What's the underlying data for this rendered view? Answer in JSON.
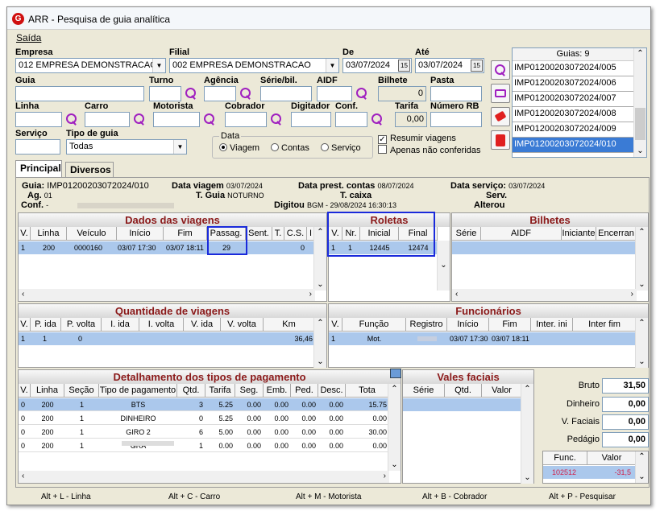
{
  "window": {
    "title": "ARR - Pesquisa de guia analítica",
    "logo": "G"
  },
  "menu": {
    "saida": "Saída"
  },
  "form": {
    "empresa_label": "Empresa",
    "empresa_value": "012 EMPRESA DEMONSTRACAO",
    "filial_label": "Filial",
    "filial_value": "002 EMPRESA DEMONSTRACAO",
    "de_label": "De",
    "de_value": "03/07/2024",
    "ate_label": "Até",
    "ate_value": "03/07/2024",
    "guia_label": "Guia",
    "turno_label": "Turno",
    "agencia_label": "Agência",
    "serie_label": "Série/bil.",
    "aidf_label": "AIDF",
    "bilhete_label": "Bilhete",
    "bilhete_value": "0",
    "pasta_label": "Pasta",
    "linha_label": "Linha",
    "carro_label": "Carro",
    "motorista_label": "Motorista",
    "cobrador_label": "Cobrador",
    "digitador_label": "Digitador",
    "conf_label": "Conf.",
    "tarifa_label": "Tarifa",
    "tarifa_value": "0,00",
    "numero_rb_label": "Número RB",
    "servico_label": "Serviço",
    "tipo_guia_label": "Tipo de guia",
    "tipo_guia_value": "Todas",
    "data_group_label": "Data",
    "data_viagem": "Viagem",
    "data_contas": "Contas",
    "data_servico": "Serviço",
    "resumir_label": "Resumir viagens",
    "apenas_label": "Apenas não conferidas"
  },
  "guias": {
    "header": "Guias: 9",
    "items": [
      "IMP01200203072024/005",
      "IMP01200203072024/006",
      "IMP01200203072024/007",
      "IMP01200203072024/008",
      "IMP01200203072024/009",
      "IMP01200203072024/010"
    ]
  },
  "tabs": {
    "principal": "Principal",
    "diversos": "Diversos"
  },
  "info": {
    "guia_label": "Guia:",
    "guia_value": "IMP01200203072024/010",
    "data_viagem_label": "Data viagem",
    "data_viagem_value": "03/07/2024",
    "data_prest_label": "Data prest. contas",
    "data_prest_value": "08/07/2024",
    "data_servico_label": "Data serviço:",
    "data_servico_value": "03/07/2024",
    "ag_label": "Ag.",
    "ag_value": "01",
    "t_guia_label": "T. Guia",
    "t_guia_value": "NOTURNO",
    "t_caixa_label": "T. caixa",
    "serv_label": "Serv.",
    "conf_label": "Conf.",
    "conf_value": "-",
    "digitou_label": "Digitou",
    "digitou_value": "BGM - 29/08/2024 16:30:13",
    "alterou_label": "Alterou"
  },
  "viagens": {
    "title": "Dados das viagens",
    "cols": [
      "V.",
      "Linha",
      "Veículo",
      "Início",
      "Fim",
      "Passag.",
      "Sent.",
      "T.",
      "C.S.",
      "I"
    ],
    "row": [
      "1",
      "200",
      "0000160",
      "03/07 17:30",
      "03/07 18:11",
      "29",
      "",
      "",
      "0",
      ""
    ]
  },
  "roletas": {
    "title": "Roletas",
    "cols": [
      "V.",
      "Nr.",
      "Inicial",
      "Final"
    ],
    "row": [
      "1",
      "1",
      "12445",
      "12474"
    ]
  },
  "bilhetes": {
    "title": "Bilhetes",
    "cols": [
      "Série",
      "AIDF",
      "Iniciante",
      "Encerran"
    ]
  },
  "quantidade": {
    "title": "Quantidade de viagens",
    "cols": [
      "V.",
      "P. ida",
      "P. volta",
      "I. ida",
      "I. volta",
      "V. ida",
      "V. volta",
      "Km"
    ],
    "row": [
      "1",
      "1",
      "0",
      "",
      "",
      "",
      "",
      "36,46"
    ]
  },
  "funcionarios": {
    "title": "Funcionários",
    "cols": [
      "V.",
      "Função",
      "Registro",
      "Início",
      "Fim",
      "Inter. ini",
      "Inter fim"
    ],
    "row": [
      "1",
      "Mot.",
      "",
      "03/07 17:30",
      "03/07 18:11",
      "",
      ""
    ]
  },
  "pagamento": {
    "title": "Detalhamento dos tipos de pagamento",
    "cols": [
      "V.",
      "Linha",
      "Seção",
      "Tipo de pagamento",
      "Qtd.",
      "Tarifa",
      "Seg.",
      "Emb.",
      "Ped.",
      "Desc.",
      "Tota"
    ],
    "rows": [
      [
        "0",
        "200",
        "1",
        "BTS",
        "3",
        "5.25",
        "0.00",
        "0.00",
        "0.00",
        "0.00",
        "15.75"
      ],
      [
        "0",
        "200",
        "1",
        "DINHEIRO",
        "0",
        "5.25",
        "0.00",
        "0.00",
        "0.00",
        "0.00",
        "0.00"
      ],
      [
        "0",
        "200",
        "1",
        "GIRO 2",
        "6",
        "5.00",
        "0.00",
        "0.00",
        "0.00",
        "0.00",
        "30.00"
      ],
      [
        "0",
        "200",
        "1",
        "GRA",
        "1",
        "0.00",
        "0.00",
        "0.00",
        "0.00",
        "0.00",
        "0.00"
      ]
    ]
  },
  "vales": {
    "title": "Vales faciais",
    "cols": [
      "Série",
      "Qtd.",
      "Valor"
    ]
  },
  "totals": {
    "bruto_label": "Bruto",
    "bruto_value": "31,50",
    "dinheiro_label": "Dinheiro",
    "dinheiro_value": "0,00",
    "vfaciais_label": "V. Faciais",
    "vfaciais_value": "0,00",
    "pedagio_label": "Pedágio",
    "pedagio_value": "0,00"
  },
  "func_valor": {
    "cols": [
      "Func.",
      "Valor"
    ],
    "row": [
      "102512",
      "-31,5"
    ]
  },
  "status": {
    "linha": "Alt + L - Linha",
    "carro": "Alt + C - Carro",
    "motorista": "Alt + M - Motorista",
    "cobrador": "Alt + B - Cobrador",
    "pesquisar": "Alt + P - Pesquisar"
  },
  "colors": {
    "selection": "#3a7bd5",
    "row_selected": "#abc8ec",
    "section_title": "#8b1a1a",
    "highlight_box": "#1a2adb",
    "search_icon": "#a020c0"
  }
}
